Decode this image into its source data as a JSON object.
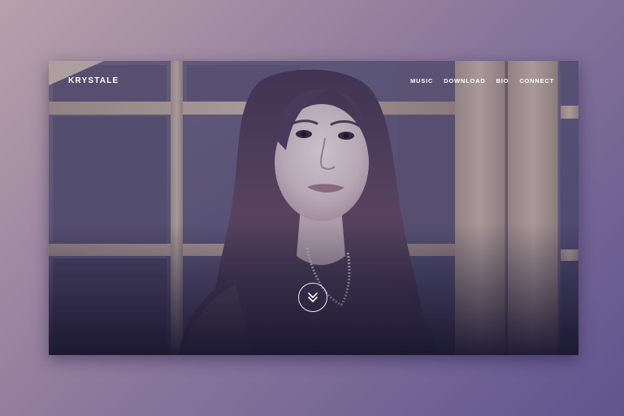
{
  "brand": "KRYSTALE",
  "nav": {
    "items": [
      {
        "label": "MUSIC"
      },
      {
        "label": "DOWNLOAD"
      },
      {
        "label": "BIO"
      },
      {
        "label": "CONNECT"
      }
    ]
  },
  "hero": {
    "scroll_icon": "double-chevron-down-icon"
  },
  "colors": {
    "tint": "#4a4478",
    "wood": "#b7a394",
    "text": "#ffffff"
  }
}
